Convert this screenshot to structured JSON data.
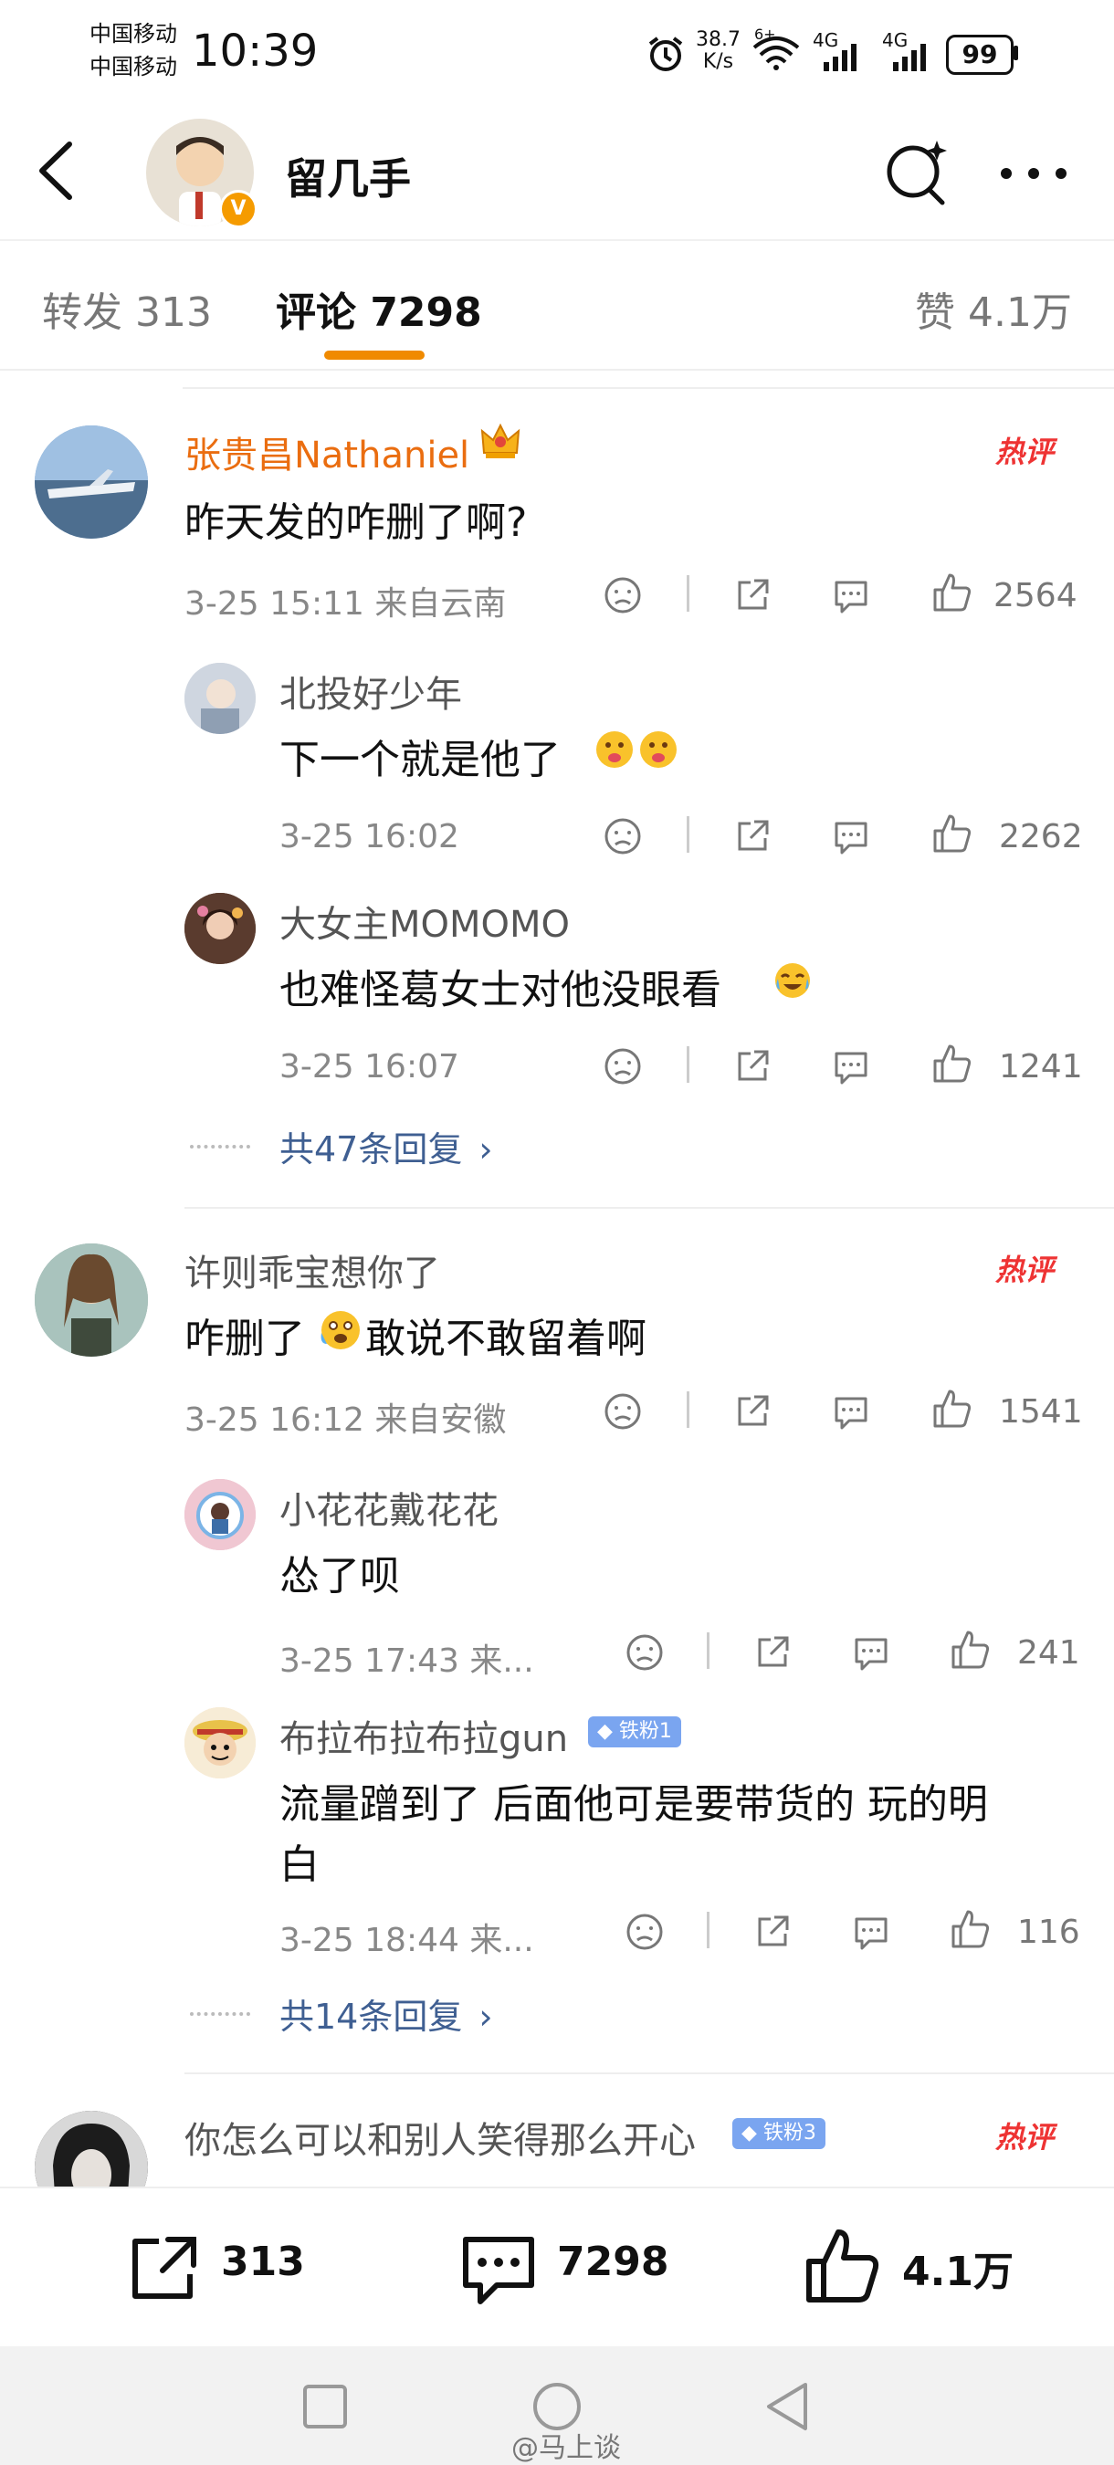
{
  "status_bar": {
    "carrier_1": "中国移动",
    "carrier_2": "中国移动",
    "time": "10:39",
    "speed_value": "38.7",
    "speed_unit": "K/s",
    "wifi_tag": "6+",
    "net_1": "4G",
    "net_2": "4G",
    "battery": "99"
  },
  "header": {
    "username": "留几手",
    "verified_badge": "V"
  },
  "tabs": {
    "repost": "转发 313",
    "comment": "评论 7298",
    "like": "赞 4.1万"
  },
  "hot_label": "热评",
  "comments": [
    {
      "user": "张贵昌Nathaniel",
      "text": "昨天发的咋删了啊?",
      "time": "3-25 15:11 来自云南",
      "likes": "2564",
      "replies": [
        {
          "user": "北投好少年",
          "text": "下一个就是他了",
          "time": "3-25 16:02",
          "likes": "2262"
        },
        {
          "user": "大女主MOMOMO",
          "text": "也难怪葛女士对他没眼看",
          "time": "3-25 16:07",
          "likes": "1241"
        }
      ],
      "more_replies": "共47条回复"
    },
    {
      "user": "许则乖宝想你了",
      "text_a": "咋删了",
      "text_b": "敢说不敢留着啊",
      "time": "3-25 16:12 来自安徽",
      "likes": "1541",
      "replies": [
        {
          "user": "小花花戴花花",
          "text": "怂了呗",
          "time": "3-25 17:43 来...",
          "likes": "241"
        },
        {
          "user": "布拉布拉布拉gun",
          "badge": "铁粉1",
          "text_line1": "流量蹭到了 后面他可是要带货的 玩的明",
          "text_line2": "白",
          "time": "3-25 18:44 来...",
          "likes": "116"
        }
      ],
      "more_replies": "共14条回复"
    },
    {
      "user": "你怎么可以和别人笑得那么开心",
      "badge": "铁粉3"
    }
  ],
  "bottom_bar": {
    "repost_count": "313",
    "comment_count": "7298",
    "like_count": "4.1万"
  },
  "watermark": "@马上谈",
  "colors": {
    "accent": "#f08a00",
    "hot_name": "#ea6d10",
    "link": "#3f5f92",
    "hot_tag": "#e33333"
  }
}
